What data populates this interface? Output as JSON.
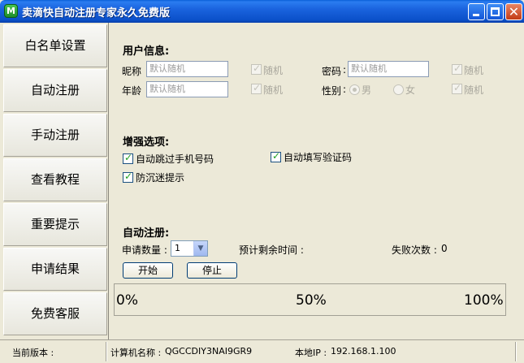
{
  "window": {
    "title": "卖滴快自动注册专家永久免费版",
    "icon_letter": "M"
  },
  "sidebar": {
    "items": [
      {
        "label": "白名单设置"
      },
      {
        "label": "自动注册"
      },
      {
        "label": "手动注册"
      },
      {
        "label": "查看教程"
      },
      {
        "label": "重要提示"
      },
      {
        "label": "申请结果"
      },
      {
        "label": "免费客服"
      }
    ]
  },
  "user_info": {
    "title": "用户信息:",
    "nickname_label": "昵称",
    "nickname_placeholder": "默认随机",
    "age_label": "年龄",
    "age_placeholder": "默认随机",
    "password_label": "密码",
    "password_placeholder": "默认随机",
    "gender_label": "性别",
    "random_label": "随机",
    "male_label": "男",
    "female_label": "女"
  },
  "enhance": {
    "title": "增强选项:",
    "skip_phone": "自动跳过手机号码",
    "auto_captcha": "自动填写验证码",
    "anti_addiction": "防沉迷提示"
  },
  "auto_register": {
    "title": "自动注册:",
    "quantity_label": "申请数量 :",
    "quantity_value": "1",
    "remaining_label": "预计剩余时间 :",
    "fail_label": "失败次数 :",
    "fail_count": "0",
    "start_button": "开始",
    "stop_button": "停止"
  },
  "progress": {
    "p0": "0%",
    "p50": "50%",
    "p100": "100%",
    "value": 0
  },
  "status": {
    "version_label": "当前版本 :",
    "computer_label": "计算机名称 :",
    "computer_name": "QGCCDIY3NAI9GR9",
    "ip_label": "本地IP :",
    "ip": "192.168.1.100"
  }
}
